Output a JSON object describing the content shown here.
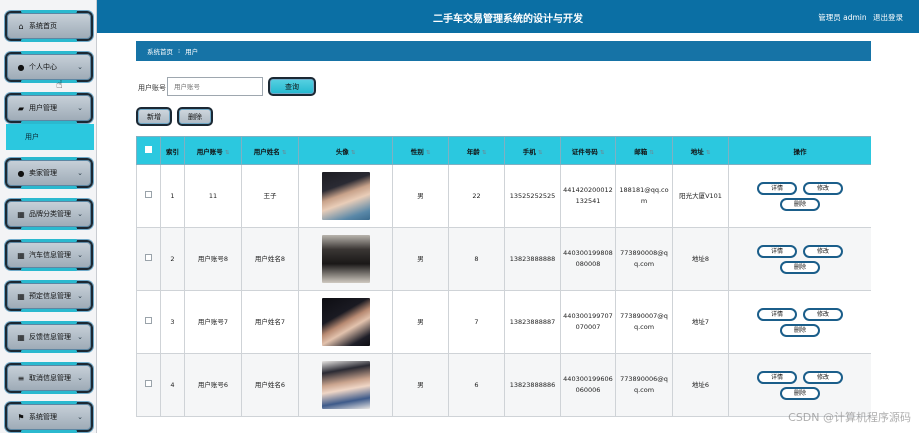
{
  "header": {
    "title": "二手车交易管理系统的设计与开发",
    "user_label": "管理员 admin",
    "logout_label": "退出登录"
  },
  "sidebar": {
    "items": [
      {
        "label": "系统首页",
        "icon": "home-icon"
      },
      {
        "label": "个人中心",
        "icon": "user-icon"
      },
      {
        "label": "用户管理",
        "icon": "users-icon"
      },
      {
        "label": "卖家管理",
        "icon": "pin-icon"
      },
      {
        "label": "品牌分类管理",
        "icon": "grid-icon"
      },
      {
        "label": "汽车信息管理",
        "icon": "grid-icon"
      },
      {
        "label": "预定信息管理",
        "icon": "grid-icon"
      },
      {
        "label": "反馈信息管理",
        "icon": "grid-icon"
      },
      {
        "label": "取消信息管理",
        "icon": "list-icon"
      },
      {
        "label": "系统管理",
        "icon": "flag-icon"
      }
    ],
    "sub_item": "用户"
  },
  "breadcrumb": {
    "home": "系统首页",
    "separator": "⁝",
    "current": "用户"
  },
  "search": {
    "label": "用户账号",
    "placeholder": "用户账号",
    "button": "查询"
  },
  "actions": {
    "add": "新增",
    "delete": "删除"
  },
  "table": {
    "headers": [
      "索引",
      "用户账号",
      "用户姓名",
      "头像",
      "性别",
      "年龄",
      "手机",
      "证件号码",
      "邮箱",
      "地址",
      "操作"
    ],
    "rows": [
      {
        "index": "1",
        "account": "11",
        "name": "王子",
        "gender": "男",
        "age": "22",
        "phone": "13525252525",
        "id_no": "441420200012132541",
        "email": "188181@qq.com",
        "address": "阳光大厦V101"
      },
      {
        "index": "2",
        "account": "用户账号8",
        "name": "用户姓名8",
        "gender": "男",
        "age": "8",
        "phone": "13823888888",
        "id_no": "440300199808080008",
        "email": "773890008@qq.com",
        "address": "地址8"
      },
      {
        "index": "3",
        "account": "用户账号7",
        "name": "用户姓名7",
        "gender": "男",
        "age": "7",
        "phone": "13823888887",
        "id_no": "440300199707070007",
        "email": "773890007@qq.com",
        "address": "地址7"
      },
      {
        "index": "4",
        "account": "用户账号6",
        "name": "用户姓名6",
        "gender": "男",
        "age": "6",
        "phone": "13823888886",
        "id_no": "440300199606060006",
        "email": "773890006@qq.com",
        "address": "地址6"
      }
    ],
    "row_ops": {
      "detail": "详情",
      "edit": "修改",
      "delete": "删除"
    }
  },
  "watermark": "CSDN @计算机程序源码",
  "colors": {
    "header_bg": "#0b6fa4",
    "accent": "#2bc8df",
    "breadcrumb_bg": "#1673a6"
  }
}
